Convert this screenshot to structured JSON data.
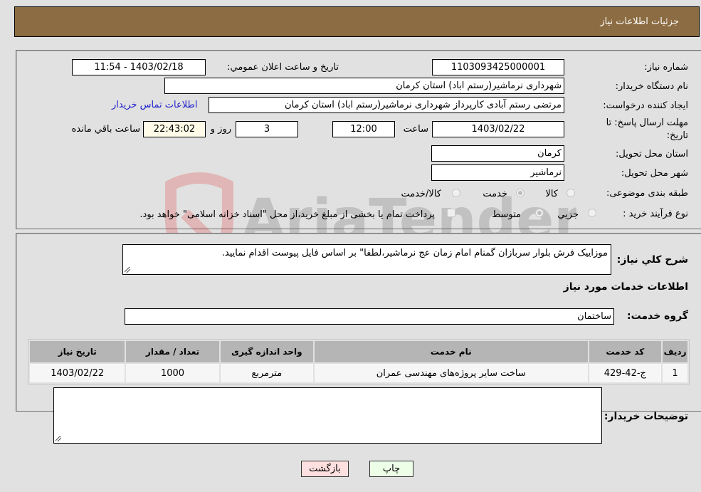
{
  "header": {
    "title": "جزئیات اطلاعات نیاز"
  },
  "form": {
    "need_number": {
      "label": "شماره نیاز:",
      "value": "1103093425000001"
    },
    "announce_datetime": {
      "label": "تاریخ و ساعت اعلان عمومي:",
      "value": "1403/02/18 - 11:54"
    },
    "buyer_org": {
      "label": "نام دستگاه خریدار:",
      "value": "شهرداری نرماشیر(رستم اباد) استان کرمان"
    },
    "requester": {
      "label": "ایجاد کننده درخواست:",
      "value": "مرتضی رستم آبادی کارپرداز شهرداری نرماشیر(رستم اباد) استان کرمان"
    },
    "buyer_contact_link": "اطلاعات تماس خریدار",
    "deadline": {
      "label": "مهلت ارسال پاسخ: تا تاریخ:",
      "date": "1403/02/22",
      "time_label": "ساعت",
      "time": "12:00",
      "days": "3",
      "days_label": "روز و",
      "remaining": "22:43:02",
      "remaining_label": "ساعت باقي مانده"
    },
    "delivery_province": {
      "label": "استان محل تحویل:",
      "value": "کرمان"
    },
    "delivery_city": {
      "label": "شهر محل تحویل:",
      "value": "نرماشیر"
    },
    "category": {
      "label": "طبقه بندی موضوعی:",
      "options": [
        "کالا",
        "خدمت",
        "کالا/خدمت"
      ],
      "selected": "خدمت"
    },
    "purchase_type": {
      "label": "نوع فرآیند خرید :",
      "options": [
        "جزیي",
        "متوسط"
      ],
      "selected": "متوسط",
      "treasury_note": "پرداخت تمام یا بخشی از مبلغ خرید،از محل \"اسناد خزانه اسلامی\" خواهد بود."
    }
  },
  "services": {
    "description_label": "شرح کلي نیاز:",
    "description": "موزاییک فرش بلوار سربازان گمنام امام زمان عج نرماشیر،لطفا\" بر اساس فایل پیوست اقدام نمایید.",
    "section_title": "اطلاعات خدمات مورد نیاز",
    "group_label": "گروه خدمت:",
    "group_value": "ساختمان",
    "table": {
      "headers": [
        "ردیف",
        "کد خدمت",
        "نام خدمت",
        "واحد اندازه گیری",
        "تعداد / مقدار",
        "تاریخ نیاز"
      ],
      "rows": [
        [
          "1",
          "ج-42-429",
          "ساخت سایر پروژه‌های مهندسی عمران",
          "مترمربع",
          "1000",
          "1403/02/22"
        ]
      ]
    },
    "buyer_notes_label": "توضیحات خریدار:",
    "buyer_notes": ""
  },
  "buttons": {
    "print": "چاپ",
    "back": "بازگشت"
  },
  "watermark": "AriaTender.neT",
  "colors": {
    "header_bg": "#8c6c42",
    "link": "#2222cc",
    "print_bg": "#eeffe8",
    "back_bg": "#ffe0e0"
  }
}
